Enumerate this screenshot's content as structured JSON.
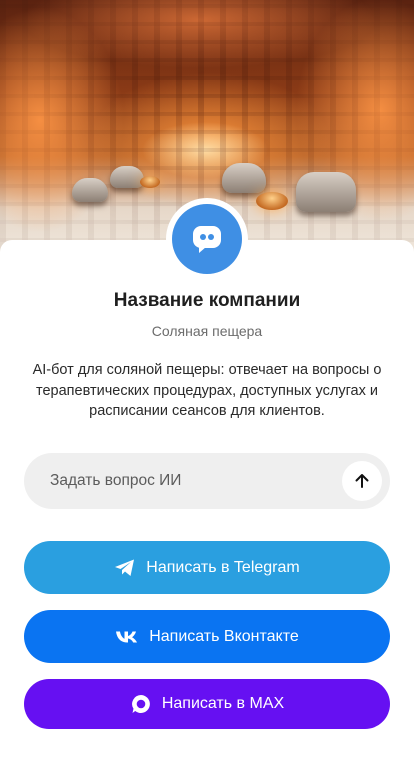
{
  "company": {
    "name": "Название компании",
    "category": "Соляная пещера",
    "description": "AI-бот для соляной пещеры: отвечает на вопросы о терапевтических процедурах, доступных услугах и расписании сеансов для клиентов."
  },
  "ask": {
    "placeholder": "Задать вопрос ИИ",
    "value": ""
  },
  "buttons": {
    "telegram": "Написать в Telegram",
    "vkontakte": "Написать Вконтакте",
    "max": "Написать в MAX"
  },
  "colors": {
    "avatar": "#3f8fe4",
    "telegram": "#2a9fe0",
    "vkontakte": "#0a74f2",
    "max": "#6610f2",
    "ask_bg": "#efefef"
  }
}
